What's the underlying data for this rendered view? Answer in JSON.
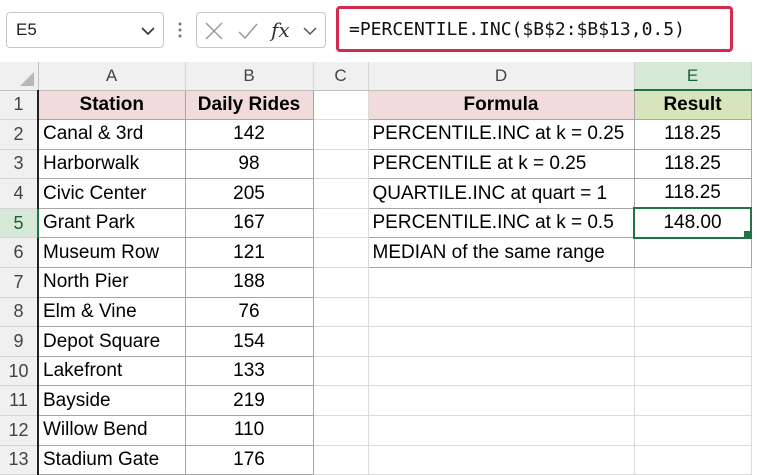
{
  "name_box": {
    "value": "E5"
  },
  "formula_bar": {
    "formula": "=PERCENTILE.INC($B$2:$B$13,0.5)",
    "fx_label": "fx"
  },
  "colors": {
    "highlight_border": "#d42a4d",
    "excel_green": "#217346",
    "header_pink": "#f2dcdb",
    "header_green": "#d8e4bc"
  },
  "columns": [
    "A",
    "B",
    "C",
    "D",
    "E"
  ],
  "rows": [
    "1",
    "2",
    "3",
    "4",
    "5",
    "6",
    "7",
    "8",
    "9",
    "10",
    "11",
    "12",
    "13"
  ],
  "table_left": {
    "headers": [
      "Station",
      "Daily Rides"
    ],
    "rows": [
      [
        "Canal & 3rd",
        "142"
      ],
      [
        "Harborwalk",
        "98"
      ],
      [
        "Civic Center",
        "205"
      ],
      [
        "Grant Park",
        "167"
      ],
      [
        "Museum Row",
        "121"
      ],
      [
        "North Pier",
        "188"
      ],
      [
        "Elm & Vine",
        "76"
      ],
      [
        "Depot Square",
        "154"
      ],
      [
        "Lakefront",
        "133"
      ],
      [
        "Bayside",
        "219"
      ],
      [
        "Willow Bend",
        "110"
      ],
      [
        "Stadium Gate",
        "176"
      ]
    ]
  },
  "table_right": {
    "headers": [
      "Formula",
      "Result"
    ],
    "rows": [
      [
        "PERCENTILE.INC at k = 0.25",
        "118.25"
      ],
      [
        "PERCENTILE at k = 0.25",
        "118.25"
      ],
      [
        "QUARTILE.INC at quart = 1",
        "118.25"
      ],
      [
        "PERCENTILE.INC at k = 0.5",
        "148.00"
      ],
      [
        "MEDIAN of the same range",
        ""
      ]
    ]
  }
}
